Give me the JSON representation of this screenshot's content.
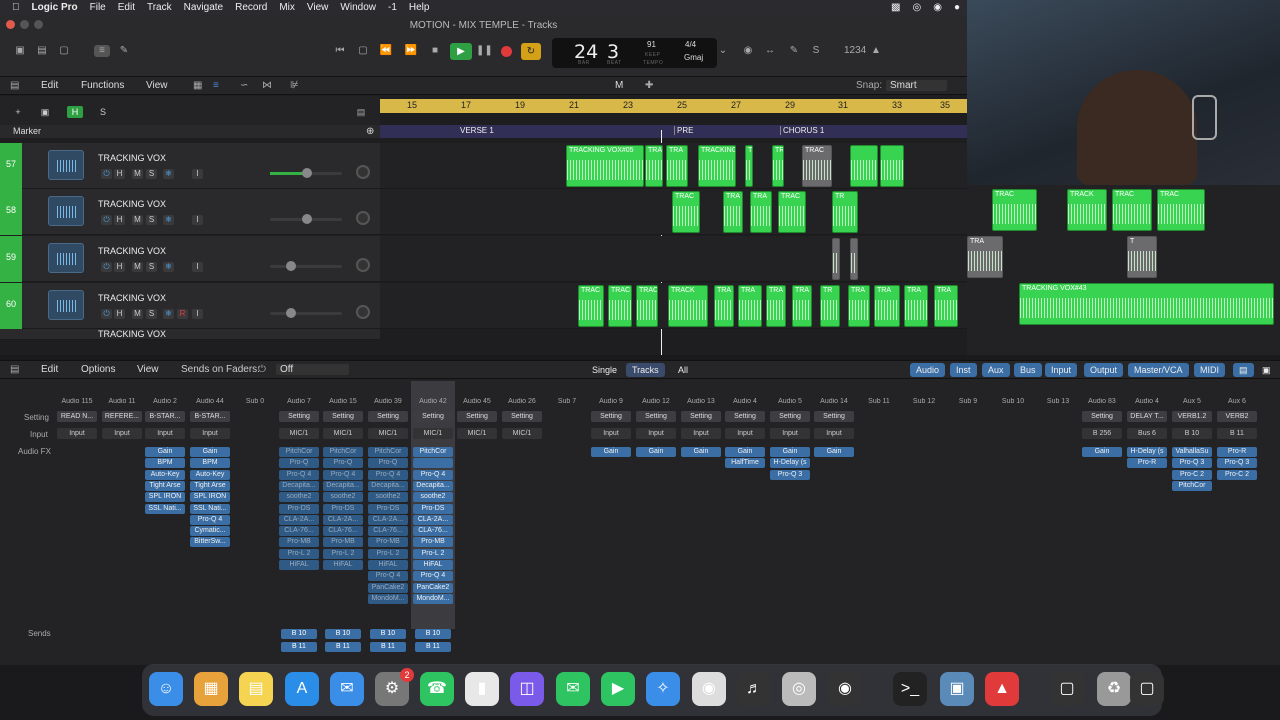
{
  "menubar": {
    "apple": "",
    "items": [
      "Logic Pro",
      "File",
      "Edit",
      "Track",
      "Navigate",
      "Record",
      "Mix",
      "View",
      "Window",
      "-1",
      "Help"
    ]
  },
  "window": {
    "title": "MOTION - MIX TEMPLE - Tracks"
  },
  "lcd": {
    "bar": "24",
    "beat": "3",
    "bar_label": "BAR",
    "beat_label": "BEAT",
    "tempo": "91",
    "keep": "KEEP",
    "tempo_label": "TEMPO",
    "signature": "4/4",
    "key": "Gmaj"
  },
  "editbar": {
    "edit": "Edit",
    "functions": "Functions",
    "view": "View",
    "mode": "M",
    "snap_label": "Snap:",
    "snap_value": "Smart"
  },
  "trackbar": {
    "add": "+",
    "h": "H",
    "s": "S",
    "marker_label": "Marker"
  },
  "ruler": {
    "bars": [
      "15",
      "17",
      "19",
      "21",
      "23",
      "25",
      "27",
      "29",
      "31",
      "33",
      "35"
    ]
  },
  "markers": [
    "VERSE 1",
    "PRE",
    "CHORUS 1"
  ],
  "tracks": [
    {
      "num": "57",
      "name": "TRACKING VOX"
    },
    {
      "num": "58",
      "name": "TRACKING VOX"
    },
    {
      "num": "59",
      "name": "TRACKING VOX"
    },
    {
      "num": "60",
      "name": "TRACKING VOX"
    },
    {
      "num": "",
      "name": "TRACKING VOX"
    }
  ],
  "track_ctl": {
    "i": "I",
    "h": "H",
    "m": "M",
    "s": "S",
    "r": "R"
  },
  "regions": {
    "r57": [
      "TRACKING VOX#05",
      "TRA",
      "TRA",
      "TRACKING",
      "TRAC",
      "TRAC",
      "TRAC"
    ],
    "r58": [
      "TRAC",
      "TRA",
      "TRA",
      "TRAC",
      "TR",
      "TRACKING VOX#56",
      "TRAC",
      "TRACK",
      "TRAC",
      "TRAC"
    ],
    "r59": [
      "TRACKING VOX#22.1",
      "TRA",
      "T",
      "TR"
    ],
    "r60": [
      "TRAC",
      "TRAC",
      "TRAC",
      "TRACK",
      "TRA",
      "TRA",
      "TRA",
      "TRA",
      "TR",
      "TRA",
      "TRA",
      "TRA",
      "TRA",
      "TR",
      "TRACKING VOX#43"
    ]
  },
  "mixbar": {
    "edit": "Edit",
    "options": "Options",
    "view": "View",
    "sends_on_faders": "Sends on Faders:",
    "sends_value": "Off",
    "single": "Single",
    "tracks": "Tracks",
    "all": "All",
    "filters": [
      "Audio",
      "Inst",
      "Aux",
      "Bus",
      "Input",
      "Output",
      "Master/VCA",
      "MIDI"
    ]
  },
  "mixer_rows": {
    "setting": "Setting",
    "input": "Input",
    "audio_fx": "Audio FX",
    "sends": "Sends"
  },
  "strips": [
    {
      "name": "Audio 115",
      "setting": "READ N...",
      "input": "Input",
      "fx": [],
      "sends": []
    },
    {
      "name": "Audio 11",
      "setting": "REFERE...",
      "input": "Input",
      "fx": [],
      "sends": []
    },
    {
      "name": "Audio 2",
      "setting": "B-STAR...",
      "input": "Input",
      "fx": [
        "Gain",
        "BPM",
        "Auto-Key",
        "Tight Arse",
        "SPL IRON",
        "SSL Nati..."
      ],
      "sends": []
    },
    {
      "name": "Audio 44",
      "setting": "B-STAR...",
      "input": "Input",
      "fx": [
        "Gain",
        "BPM",
        "Auto-Key",
        "Tight Arse",
        "SPL IRON",
        "SSL Nati...",
        "Pro-Q 4",
        "Cymatic...",
        "BitterSw..."
      ],
      "sends": []
    },
    {
      "name": "Sub 0",
      "setting": "",
      "input": "",
      "fx": [],
      "sends": []
    },
    {
      "name": "Audio 7",
      "setting": "Setting",
      "input": "MIC/1",
      "fx": [
        "PitchCor",
        "Pro-Q",
        "Pro-Q 4",
        "Decapita...",
        "soothe2",
        "Pro-DS",
        "CLA-2A...",
        "CLA-76...",
        "Pro-MB",
        "Pro-L 2",
        "HiFAL"
      ],
      "sends": [
        "B 10",
        "B 11"
      ]
    },
    {
      "name": "Audio 15",
      "setting": "Setting",
      "input": "MIC/1",
      "fx": [
        "PitchCor",
        "Pro-Q",
        "Pro-Q 4",
        "Decapita...",
        "soothe2",
        "Pro-DS",
        "CLA-2A...",
        "CLA-76...",
        "Pro-MB",
        "Pro-L 2",
        "HiFAL"
      ],
      "sends": [
        "B 10",
        "B 11"
      ]
    },
    {
      "name": "Audio 39",
      "setting": "Setting",
      "input": "MIC/1",
      "fx": [
        "PitchCor",
        "Pro-Q",
        "Pro-Q 4",
        "Decapita...",
        "soothe2",
        "Pro-DS",
        "CLA-2A...",
        "CLA-76...",
        "Pro-MB",
        "Pro-L 2",
        "HiFAL",
        "Pro-Q 4",
        "PanCake2",
        "MondoM..."
      ],
      "sends": [
        "B 10",
        "B 11"
      ]
    },
    {
      "name": "Audio 42",
      "setting": "Setting",
      "input": "MIC/1",
      "fx": [
        "PitchCor",
        "",
        "Pro-Q 4",
        "Decapita...",
        "soothe2",
        "Pro-DS",
        "CLA-2A...",
        "CLA-76...",
        "Pro-MB",
        "Pro-L 2",
        "HiFAL",
        "Pro-Q 4",
        "PanCake2",
        "MondoM..."
      ],
      "sends": [
        "B 10",
        "B 11"
      ]
    },
    {
      "name": "Audio 45",
      "setting": "Setting",
      "input": "MIC/1",
      "fx": [],
      "sends": []
    },
    {
      "name": "Audio 26",
      "setting": "Setting",
      "input": "MIC/1",
      "fx": [],
      "sends": []
    },
    {
      "name": "Sub 7",
      "setting": "",
      "input": "",
      "fx": [],
      "sends": []
    },
    {
      "name": "Audio 9",
      "setting": "Setting",
      "input": "Input",
      "fx": [
        "Gain"
      ],
      "sends": []
    },
    {
      "name": "Audio 12",
      "setting": "Setting",
      "input": "Input",
      "fx": [
        "Gain"
      ],
      "sends": []
    },
    {
      "name": "Audio 13",
      "setting": "Setting",
      "input": "Input",
      "fx": [
        "Gain"
      ],
      "sends": []
    },
    {
      "name": "Audio 4",
      "setting": "Setting",
      "input": "Input",
      "fx": [
        "Gain",
        "HalfTime"
      ],
      "sends": []
    },
    {
      "name": "Audio 5",
      "setting": "Setting",
      "input": "Input",
      "fx": [
        "Gain",
        "H-Delay (s",
        "Pro-Q 3"
      ],
      "sends": []
    },
    {
      "name": "Audio 14",
      "setting": "Setting",
      "input": "Input",
      "fx": [
        "Gain"
      ],
      "sends": []
    },
    {
      "name": "Sub 11",
      "setting": "",
      "input": "",
      "fx": [],
      "sends": []
    },
    {
      "name": "Sub 12",
      "setting": "",
      "input": "",
      "fx": [],
      "sends": []
    },
    {
      "name": "Sub 9",
      "setting": "",
      "input": "",
      "fx": [],
      "sends": []
    },
    {
      "name": "Sub 10",
      "setting": "",
      "input": "",
      "fx": [],
      "sends": []
    },
    {
      "name": "Sub 13",
      "setting": "",
      "input": "",
      "fx": [],
      "sends": []
    },
    {
      "name": "Audio 83",
      "setting": "Setting",
      "input": "B 256",
      "fx": [
        "Gain"
      ],
      "sends": []
    },
    {
      "name": "Audio 4",
      "setting": "DELAY T...",
      "input": "Bus 6",
      "fx": [
        "H-Delay (s",
        "Pro-R"
      ],
      "sends": []
    },
    {
      "name": "Aux 5",
      "setting": "VERB1.2",
      "input": "B 10",
      "fx": [
        "ValhallaSu",
        "Pro-Q 3",
        "Pro-C 2",
        "PitchCor"
      ],
      "sends": []
    },
    {
      "name": "Aux 6",
      "setting": "VERB2",
      "input": "B 11",
      "fx": [
        "Pro-R",
        "Pro-Q 3",
        "Pro-C 2"
      ],
      "sends": []
    }
  ],
  "dock": {
    "settings_badge": "2",
    "items": [
      "finder-icon",
      "launchpad-icon",
      "notes-icon",
      "app-store-icon",
      "mail-icon",
      "system-settings-icon",
      "whatsapp-icon",
      "flashcard-icon",
      "mirror-icon",
      "messages-icon",
      "facetime-icon",
      "safari-icon",
      "logic-pro-icon",
      "utility-icon",
      "audio-disk-icon",
      "obs-icon",
      "terminal-icon",
      "preview-icon",
      "acrobat-icon",
      "screen-icon",
      "trash-icon",
      "window-icon"
    ]
  },
  "colors": {
    "region_green": "#39d352",
    "track_number": "#35b244",
    "ruler": "#d9b84a",
    "plugin_blue": "#3a6ea5",
    "play": "#2ea043",
    "record": "#e03a3a",
    "cycle": "#d4a017"
  }
}
